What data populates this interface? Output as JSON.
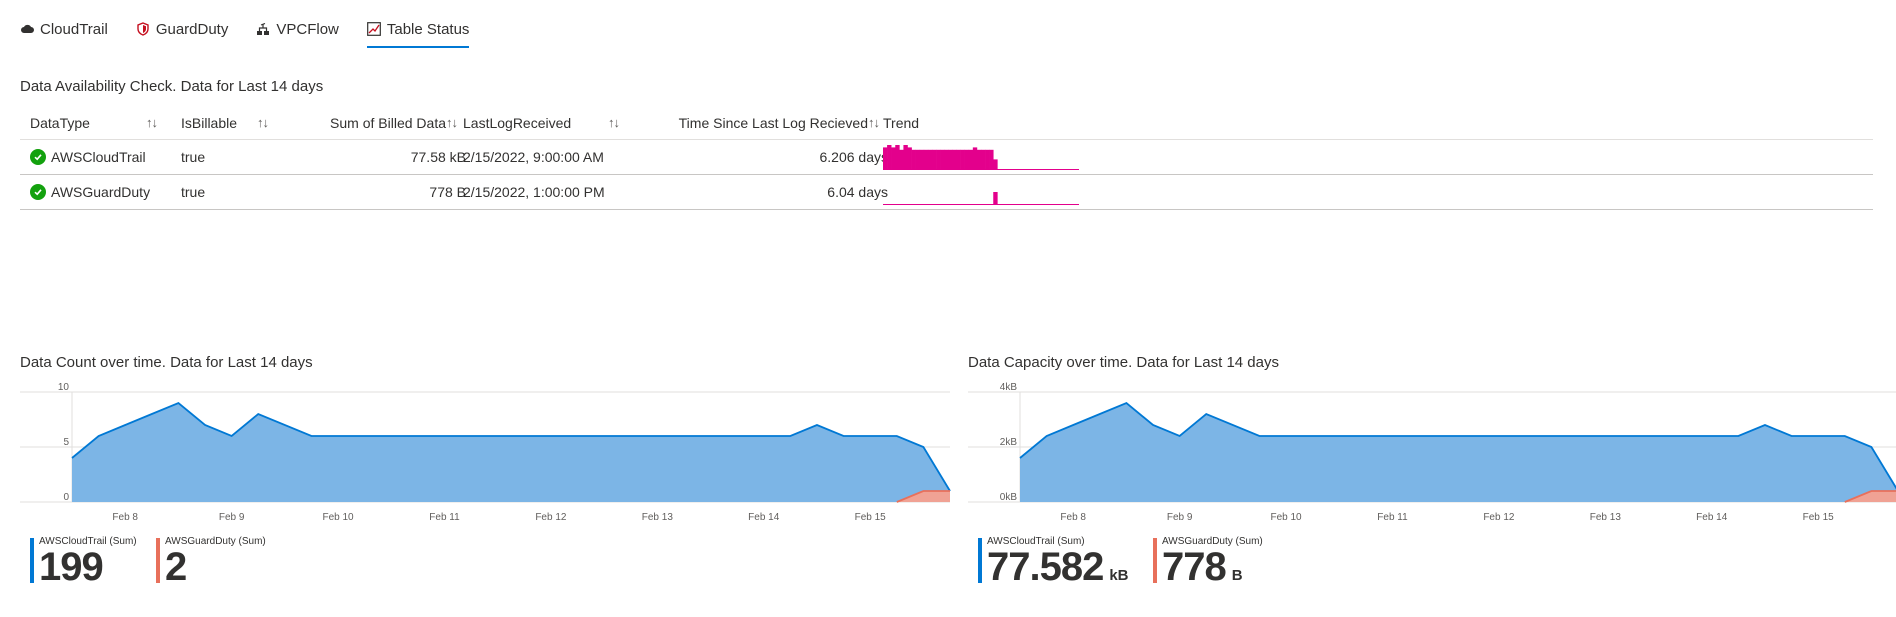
{
  "tabs": [
    {
      "label": "CloudTrail",
      "icon": "cloud-icon"
    },
    {
      "label": "GuardDuty",
      "icon": "shield-icon"
    },
    {
      "label": "VPCFlow",
      "icon": "network-icon"
    },
    {
      "label": "Table Status",
      "icon": "chart-icon",
      "active": true
    }
  ],
  "availability": {
    "title": "Data Availability Check. Data for Last 14 days",
    "columns": [
      "DataType",
      "IsBillable",
      "Sum of Billed Data",
      "LastLogReceived",
      "Time Since Last Log Recieved",
      "Trend"
    ],
    "sort_glyph": "↑↓",
    "rows": [
      {
        "datatype": "AWSCloudTrail",
        "isbillable": "true",
        "billed": "77.58 kB",
        "last": "2/15/2022, 9:00:00 AM",
        "since": "6.206 days",
        "status": "success",
        "trend": [
          9,
          10,
          9,
          10,
          8,
          10,
          9,
          8,
          8,
          8,
          8,
          8,
          8,
          8,
          8,
          8,
          8,
          8,
          8,
          8,
          8,
          8,
          9,
          8,
          8,
          8,
          8,
          4,
          0,
          0,
          0,
          0,
          0,
          0,
          0,
          0,
          0,
          0,
          0,
          0,
          0,
          0,
          0,
          0,
          0,
          0,
          0,
          0
        ]
      },
      {
        "datatype": "AWSGuardDuty",
        "isbillable": "true",
        "billed": "778 B",
        "last": "2/15/2022, 1:00:00 PM",
        "since": "6.04 days",
        "status": "success",
        "trend": [
          0,
          0,
          0,
          0,
          0,
          0,
          0,
          0,
          0,
          0,
          0,
          0,
          0,
          0,
          0,
          0,
          0,
          0,
          0,
          0,
          0,
          0,
          0,
          0,
          0,
          0,
          0,
          5,
          0,
          0,
          0,
          0,
          0,
          0,
          0,
          0,
          0,
          0,
          0,
          0,
          0,
          0,
          0,
          0,
          0,
          0,
          0,
          0
        ]
      }
    ],
    "trend_color": "#e3008c"
  },
  "charts": [
    {
      "title": "Data Count over time. Data for Last 14 days",
      "yticks": [
        "10",
        "5",
        "0"
      ],
      "xticks": [
        "Feb 8",
        "Feb 9",
        "Feb 10",
        "Feb 11",
        "Feb 12",
        "Feb 13",
        "Feb 14",
        "Feb 15"
      ],
      "legend": [
        {
          "name": "AWSCloudTrail (Sum)",
          "value": "199",
          "unit": "",
          "color": "#0078d4"
        },
        {
          "name": "AWSGuardDuty (Sum)",
          "value": "2",
          "unit": "",
          "color": "#e8705b"
        }
      ]
    },
    {
      "title": "Data Capacity over time. Data for Last 14 days",
      "yticks": [
        "4kB",
        "2kB",
        "0kB"
      ],
      "xticks": [
        "Feb 8",
        "Feb 9",
        "Feb 10",
        "Feb 11",
        "Feb 12",
        "Feb 13",
        "Feb 14",
        "Feb 15"
      ],
      "legend": [
        {
          "name": "AWSCloudTrail (Sum)",
          "value": "77.582",
          "unit": "kB",
          "color": "#0078d4"
        },
        {
          "name": "AWSGuardDuty (Sum)",
          "value": "778",
          "unit": "B",
          "color": "#e8705b"
        }
      ]
    }
  ],
  "chart_data": [
    {
      "type": "area",
      "title": "Data Count over time. Data for Last 14 days",
      "xlabel": "",
      "ylabel": "",
      "ylim": [
        0,
        10
      ],
      "x": [
        "Feb 7 12:00",
        "Feb 7 18:00",
        "Feb 8 00:00",
        "Feb 8 06:00",
        "Feb 8 12:00",
        "Feb 8 18:00",
        "Feb 9 00:00",
        "Feb 9 06:00",
        "Feb 9 18:00",
        "Feb 10 06:00",
        "Feb 14 06:00",
        "Feb 14 12:00",
        "Feb 14 18:00",
        "Feb 15 06:00",
        "Feb 15 12:00",
        "Feb 15 18:00"
      ],
      "series": [
        {
          "name": "AWSCloudTrail",
          "values": [
            4,
            6,
            7,
            8,
            9,
            7,
            6,
            8,
            6,
            6,
            6,
            7,
            6,
            6,
            5,
            1
          ],
          "color": "#0078d4"
        },
        {
          "name": "AWSGuardDuty",
          "values": [
            0,
            0,
            0,
            0,
            0,
            0,
            0,
            0,
            0,
            0,
            0,
            0,
            0,
            0,
            1,
            1
          ],
          "color": "#e8705b"
        }
      ]
    },
    {
      "type": "area",
      "title": "Data Capacity over time. Data for Last 14 days",
      "xlabel": "",
      "ylabel": "",
      "ylim": [
        0,
        4
      ],
      "yunit": "kB",
      "x": [
        "Feb 7 12:00",
        "Feb 7 18:00",
        "Feb 8 00:00",
        "Feb 8 06:00",
        "Feb 8 12:00",
        "Feb 8 18:00",
        "Feb 9 00:00",
        "Feb 9 06:00",
        "Feb 9 18:00",
        "Feb 10 06:00",
        "Feb 14 06:00",
        "Feb 14 12:00",
        "Feb 14 18:00",
        "Feb 15 06:00",
        "Feb 15 12:00",
        "Feb 15 18:00"
      ],
      "series": [
        {
          "name": "AWSCloudTrail",
          "values": [
            1.6,
            2.4,
            2.8,
            3.2,
            3.6,
            2.8,
            2.4,
            3.2,
            2.4,
            2.4,
            2.4,
            2.8,
            2.4,
            2.4,
            2.0,
            0.4
          ],
          "color": "#0078d4"
        },
        {
          "name": "AWSGuardDuty",
          "values": [
            0,
            0,
            0,
            0,
            0,
            0,
            0,
            0,
            0,
            0,
            0,
            0,
            0,
            0,
            0.4,
            0.4
          ],
          "color": "#e8705b"
        }
      ]
    }
  ]
}
